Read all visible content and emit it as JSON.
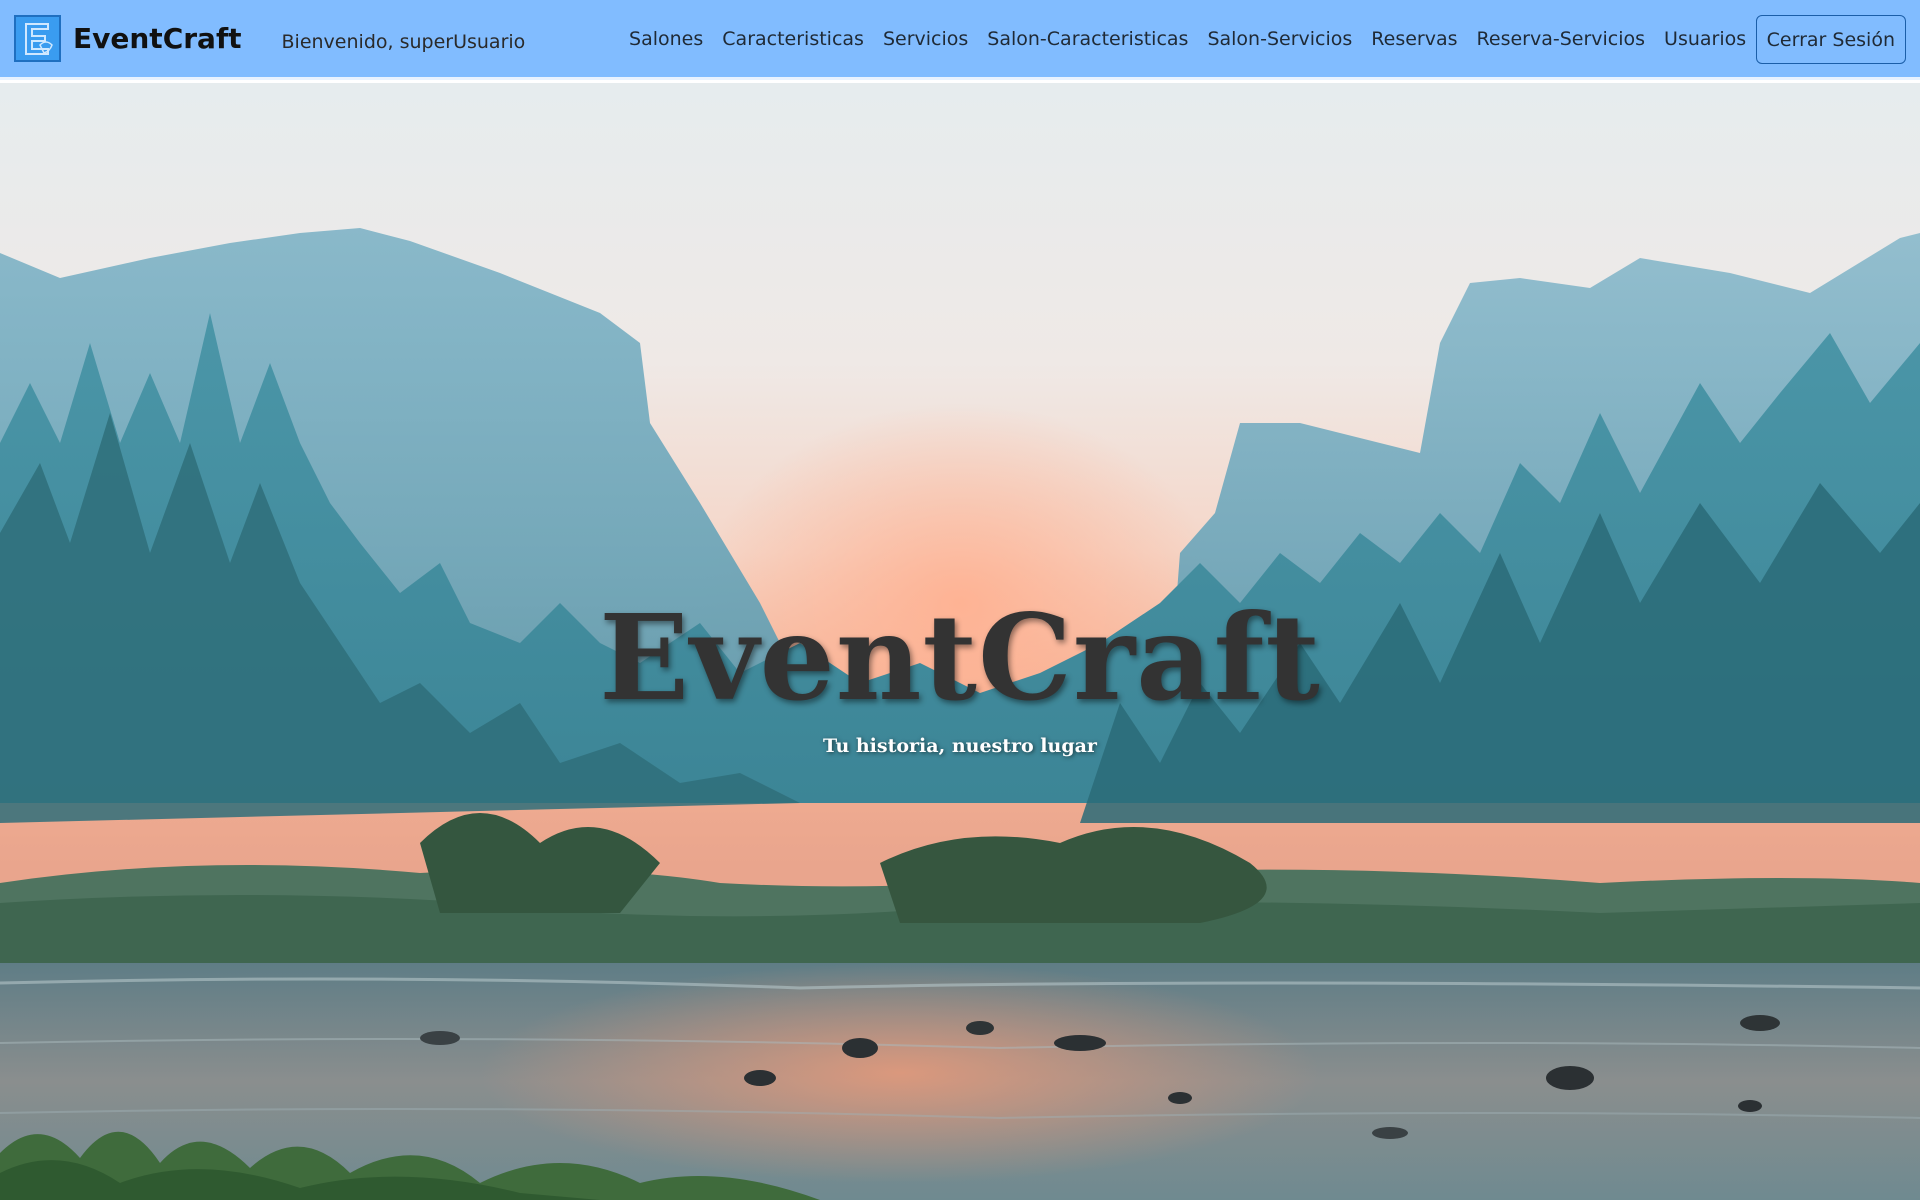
{
  "navbar": {
    "brand_name": "EventCraft",
    "logo_icon": "eventcraft-e-logo",
    "welcome_text": "Bienvenido, superUsuario",
    "links": [
      {
        "label": "Salones"
      },
      {
        "label": "Caracteristicas"
      },
      {
        "label": "Servicios"
      },
      {
        "label": "Salon-Caracteristicas"
      },
      {
        "label": "Salon-Servicios"
      },
      {
        "label": "Reservas"
      },
      {
        "label": "Reserva-Servicios"
      },
      {
        "label": "Usuarios"
      }
    ],
    "logout_label": "Cerrar Sesión",
    "background_color": "#81bcff"
  },
  "hero": {
    "title": "EventCraft",
    "subtitle": "Tu historia, nuestro lugar",
    "background": "misty valley with cliffs, pine forest and river at sunrise"
  }
}
